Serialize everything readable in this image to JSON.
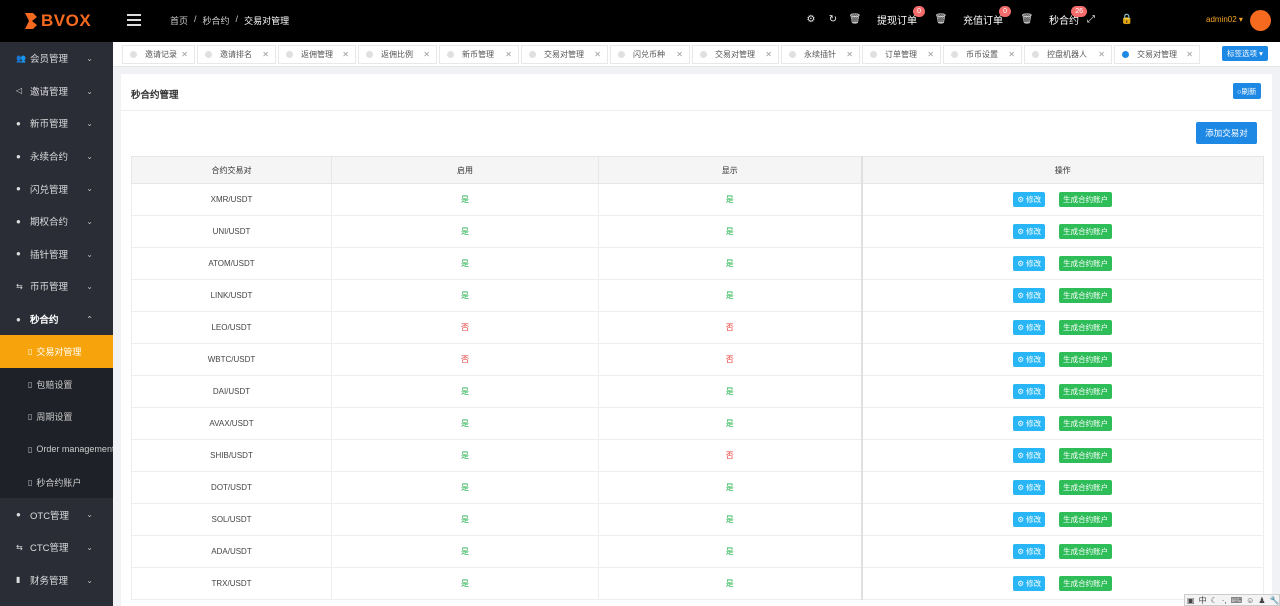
{
  "header": {
    "logo_text": "BVOX",
    "breadcrumb": [
      "首页",
      "秒合约",
      "交易对管理"
    ],
    "nav": [
      {
        "label": "提现订单",
        "badge": "0"
      },
      {
        "label": "充值订单",
        "badge": "0"
      },
      {
        "label": "秒合约",
        "badge": "26"
      }
    ],
    "user": "admin02",
    "accent": "#f56a1f"
  },
  "sidebar": {
    "items": [
      {
        "label": "会员管理",
        "icon": "users-icon"
      },
      {
        "label": "邀请管理",
        "icon": "share-icon"
      },
      {
        "label": "新币管理",
        "icon": "cube-icon"
      },
      {
        "label": "永续合约",
        "icon": "cube-icon"
      },
      {
        "label": "闪兑管理",
        "icon": "cube-icon"
      },
      {
        "label": "期权合约",
        "icon": "cube-icon"
      },
      {
        "label": "插针管理",
        "icon": "cube-icon"
      },
      {
        "label": "币币管理",
        "icon": "exchange-icon"
      },
      {
        "label": "秒合约",
        "icon": "cube-icon"
      }
    ],
    "subitems": [
      {
        "label": "交易对管理"
      },
      {
        "label": "包赔设置"
      },
      {
        "label": "周期设置"
      },
      {
        "label": "Order management"
      },
      {
        "label": "秒合约账户"
      }
    ],
    "bottom": [
      {
        "label": "OTC管理",
        "icon": "cube-icon"
      },
      {
        "label": "CTC管理",
        "icon": "exchange-icon"
      },
      {
        "label": "财务管理",
        "icon": "chart-icon"
      }
    ]
  },
  "tabs": [
    "邀请记录",
    "邀请排名",
    "返佣管理",
    "返佣比例",
    "新币管理",
    "交易对管理",
    "闪兑币种",
    "交易对管理",
    "永续插针",
    "订单管理",
    "币币设置",
    "控盘机器人",
    "交易对管理"
  ],
  "tab_select": "标签选项",
  "page": {
    "title": "秒合约管理",
    "refresh": "刷新",
    "add": "添加交易对"
  },
  "table": {
    "headers": [
      "合约交易对",
      "启用",
      "显示",
      "操作"
    ],
    "edit_label": "修改",
    "gen_label": "生成合约账户",
    "rows": [
      {
        "pair": "XMR/USDT",
        "enabled": "是",
        "shown": "是"
      },
      {
        "pair": "UNI/USDT",
        "enabled": "是",
        "shown": "是"
      },
      {
        "pair": "ATOM/USDT",
        "enabled": "是",
        "shown": "是"
      },
      {
        "pair": "LINK/USDT",
        "enabled": "是",
        "shown": "是"
      },
      {
        "pair": "LEO/USDT",
        "enabled": "否",
        "shown": "否"
      },
      {
        "pair": "WBTC/USDT",
        "enabled": "否",
        "shown": "否"
      },
      {
        "pair": "DAI/USDT",
        "enabled": "是",
        "shown": "是"
      },
      {
        "pair": "AVAX/USDT",
        "enabled": "是",
        "shown": "是"
      },
      {
        "pair": "SHIB/USDT",
        "enabled": "是",
        "shown": "否"
      },
      {
        "pair": "DOT/USDT",
        "enabled": "是",
        "shown": "是"
      },
      {
        "pair": "SOL/USDT",
        "enabled": "是",
        "shown": "是"
      },
      {
        "pair": "ADA/USDT",
        "enabled": "是",
        "shown": "是"
      },
      {
        "pair": "TRX/USDT",
        "enabled": "是",
        "shown": "是"
      }
    ]
  },
  "ime": "中"
}
